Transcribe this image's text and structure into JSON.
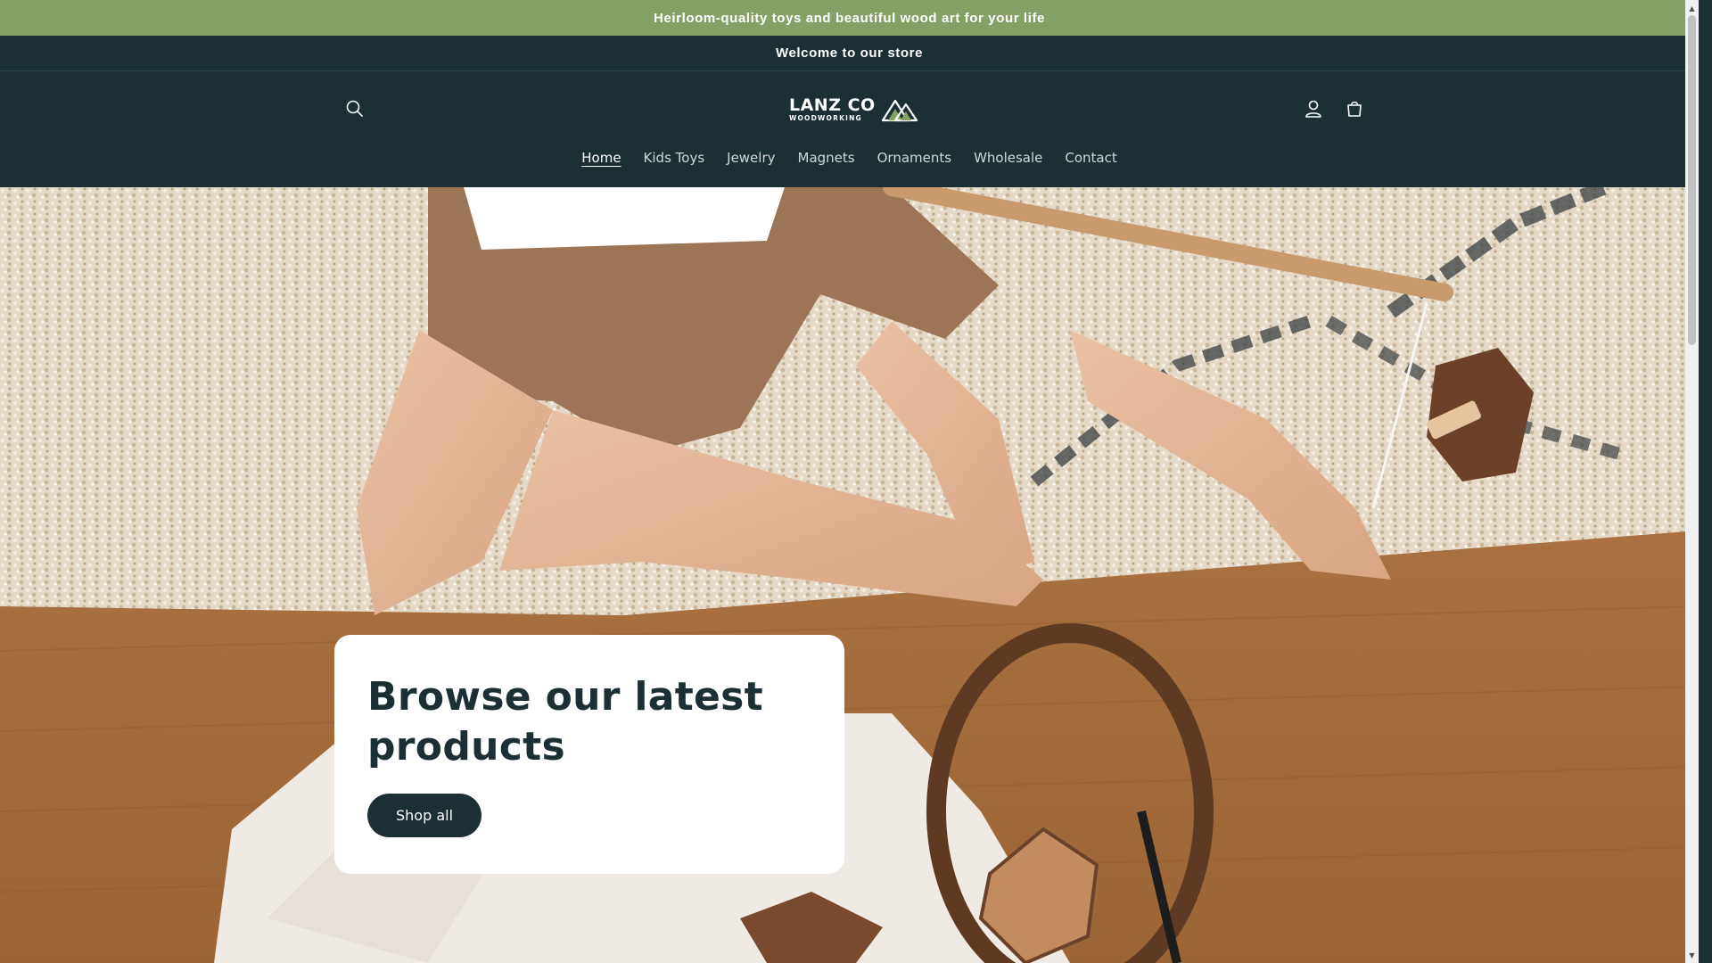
{
  "announcement": {
    "text": "Heirloom-quality toys and beautiful wood art for your life"
  },
  "header": {
    "welcome": "Welcome to our store",
    "logo": {
      "main": "LANZ CO",
      "sub": "WOODWORKING"
    },
    "icons": {
      "search": "search-icon",
      "account": "account-icon",
      "cart": "cart-icon"
    }
  },
  "nav": {
    "items": [
      {
        "label": "Home",
        "active": true
      },
      {
        "label": "Kids Toys",
        "active": false
      },
      {
        "label": "Jewelry",
        "active": false
      },
      {
        "label": "Magnets",
        "active": false
      },
      {
        "label": "Ornaments",
        "active": false
      },
      {
        "label": "Wholesale",
        "active": false
      },
      {
        "label": "Contact",
        "active": false
      }
    ]
  },
  "hero": {
    "title": "Browse our latest products",
    "button_label": "Shop all"
  },
  "colors": {
    "announcement_bg": "#86a166",
    "header_bg": "#1c2f34",
    "button_bg": "#1c2f34",
    "card_bg": "#ffffff"
  }
}
